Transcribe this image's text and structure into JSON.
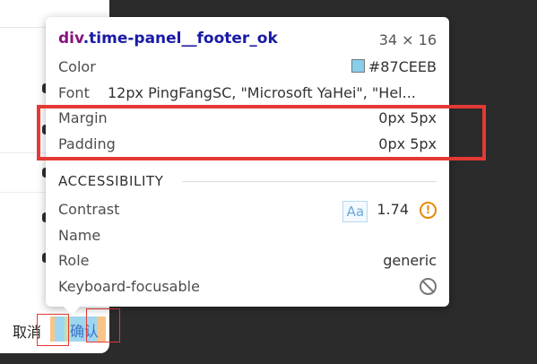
{
  "page": {
    "cancel_label": "取消",
    "ok_label": "确认"
  },
  "inspector": {
    "selector_tag": "div",
    "selector_class": ".time-panel__footer_ok",
    "dimensions": "34 × 16",
    "color_label": "Color",
    "color_value": "#87CEEB",
    "font_label": "Font",
    "font_value": "12px PingFangSC, \"Microsoft YaHei\", \"Hel...",
    "margin_label": "Margin",
    "margin_value": "0px 5px",
    "padding_label": "Padding",
    "padding_value": "0px 5px",
    "accessibility_title": "ACCESSIBILITY",
    "contrast_label": "Contrast",
    "contrast_aa": "Aa",
    "contrast_value": "1.74",
    "name_label": "Name",
    "role_label": "Role",
    "role_value": "generic",
    "keyboard_label": "Keyboard-focusable"
  },
  "colors": {
    "swatch": "#87CEEB",
    "highlight_border": "#e53935",
    "warning": "#e68a00"
  },
  "icons": [
    "color-swatch-icon",
    "aa-contrast-icon",
    "warning-icon",
    "not-focusable-icon"
  ]
}
